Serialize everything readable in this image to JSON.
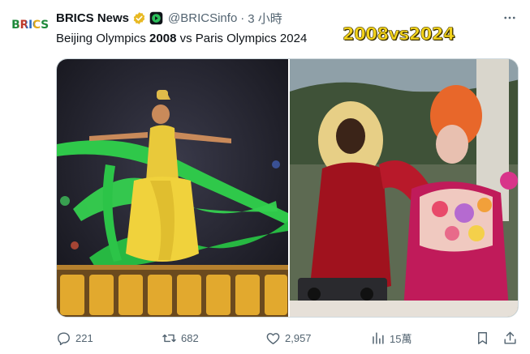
{
  "account": {
    "avatar_text": "BRICS",
    "display_name": "BRICS News",
    "handle": "@BRICSinfo",
    "separator": "·",
    "timestamp": "3 小時"
  },
  "tweet": {
    "text_part1": "Beijing Olympics ",
    "text_bold1": "2008",
    "text_part2": " vs Paris Olympics 2024"
  },
  "media": {
    "overlay_caption": "2008vs2024",
    "left_image": "Beijing 2008 ceremony dancer with green ribbons",
    "right_image": "Paris 2024 performers in red and floral costume"
  },
  "actions": {
    "replies": "221",
    "reposts": "682",
    "likes": "2,957",
    "views": "15萬"
  },
  "colors": {
    "text_primary": "#0f1419",
    "text_secondary": "#536471",
    "verified_gold": "#e8b923",
    "caption_yellow": "#f2d21a"
  },
  "icons": [
    "verified-badge-icon",
    "play-badge-icon",
    "more-icon",
    "reply-icon",
    "repost-icon",
    "like-icon",
    "views-icon",
    "bookmark-icon",
    "share-icon"
  ]
}
